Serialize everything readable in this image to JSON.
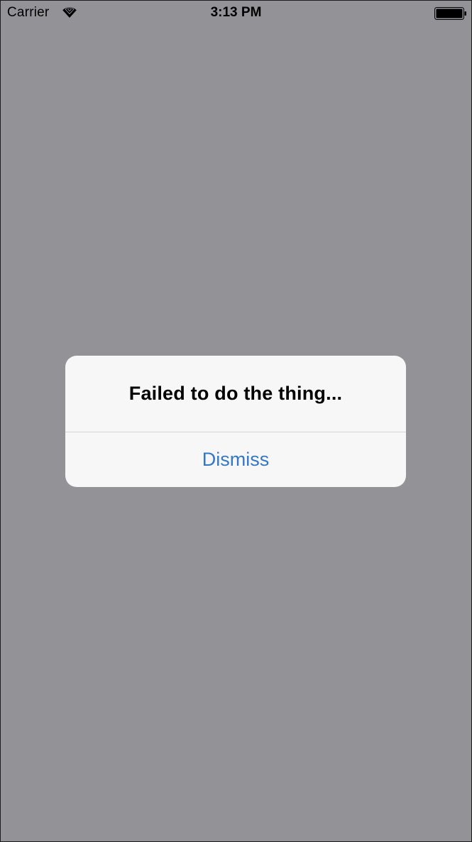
{
  "status_bar": {
    "carrier": "Carrier",
    "time": "3:13 PM",
    "wifi_icon": "wifi-icon",
    "battery_icon": "battery-icon"
  },
  "alert": {
    "title": "Failed to do the thing...",
    "dismiss_label": "Dismiss"
  },
  "colors": {
    "dimmed_background": "#939296",
    "alert_background": "#f7f7f7",
    "action_tint": "#3478c4"
  }
}
